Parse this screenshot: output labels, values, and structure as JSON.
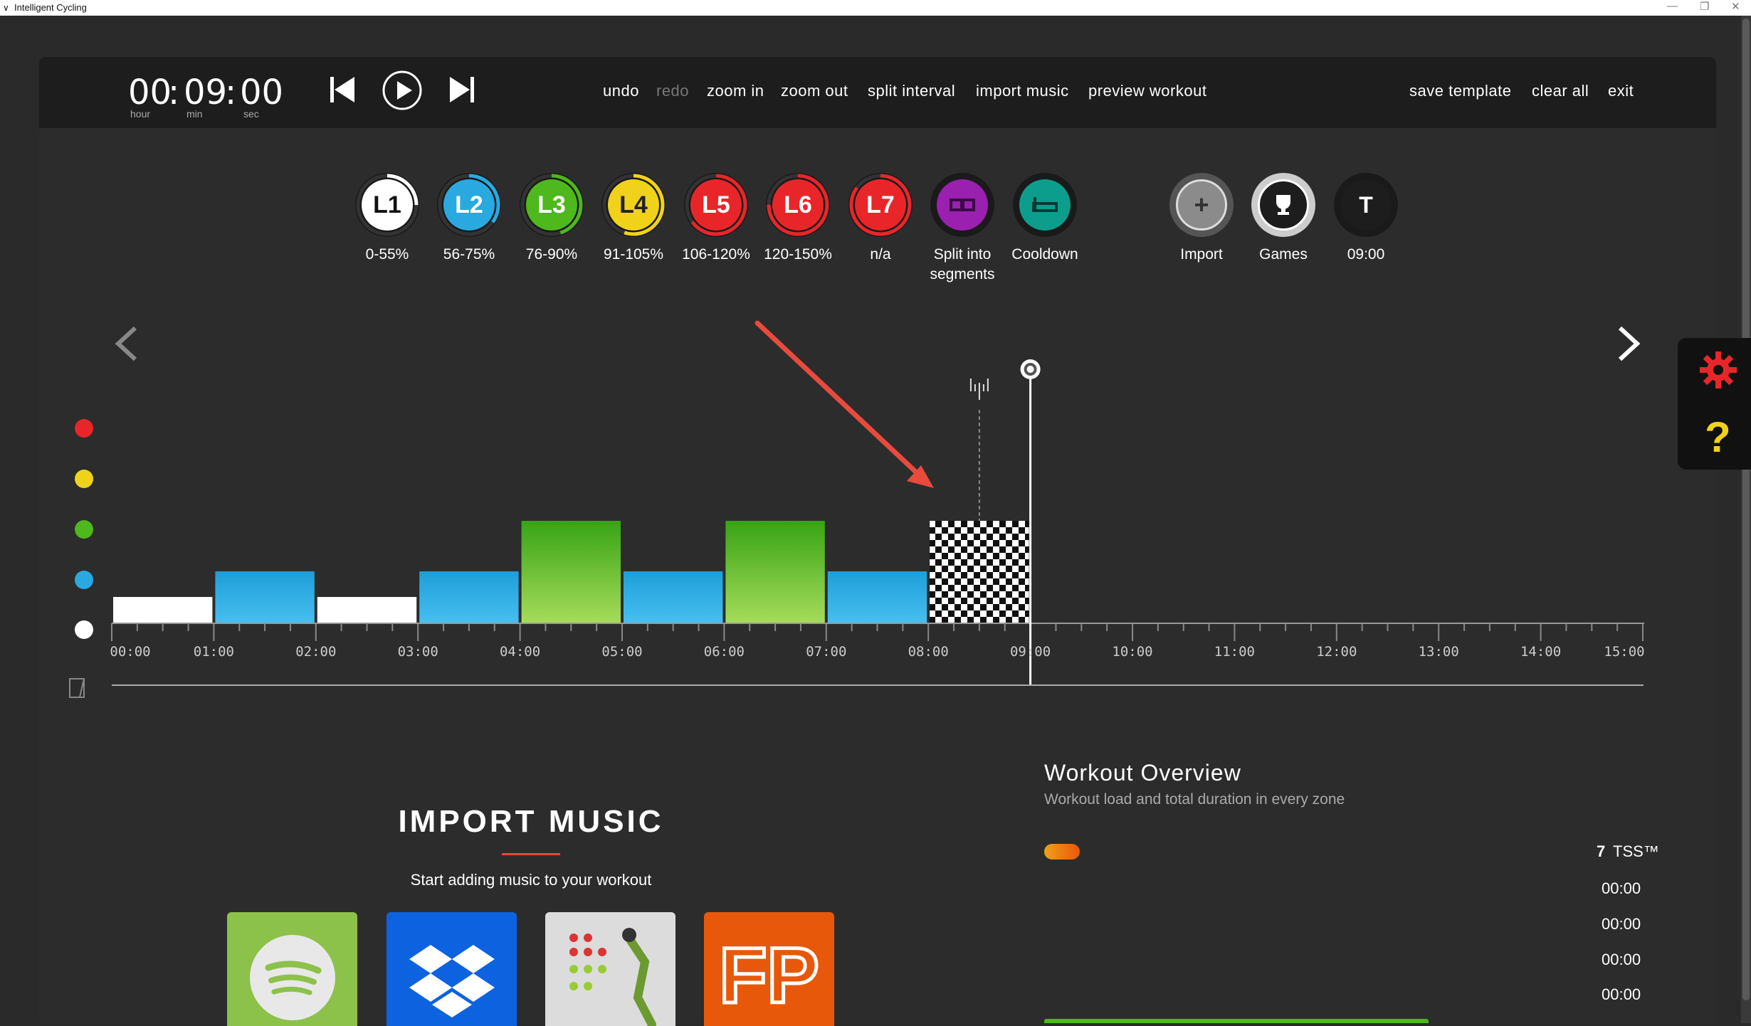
{
  "window": {
    "title": "Intelligent Cycling"
  },
  "timer": {
    "hours": "00",
    "minutes": "09",
    "seconds": "00",
    "sep": ":",
    "unit_hour": "hour",
    "unit_min": "min",
    "unit_sec": "sec"
  },
  "menu": {
    "undo": "undo",
    "redo": "redo",
    "zoom_in": "zoom in",
    "zoom_out": "zoom out",
    "split_interval": "split interval",
    "import_music": "import music",
    "preview_workout": "preview workout",
    "save_template": "save template",
    "clear_all": "clear all",
    "exit": "exit"
  },
  "zones": [
    {
      "label": "L1",
      "range": "0-55%",
      "color": "#ffffff",
      "text_color": "#111111"
    },
    {
      "label": "L2",
      "range": "56-75%",
      "color": "#29a9e0",
      "text_color": "#ffffff"
    },
    {
      "label": "L3",
      "range": "76-90%",
      "color": "#4fb81c",
      "text_color": "#ffffff"
    },
    {
      "label": "L4",
      "range": "91-105%",
      "color": "#f0d21a",
      "text_color": "#222222"
    },
    {
      "label": "L5",
      "range": "106-120%",
      "color": "#e8262a",
      "text_color": "#ffffff"
    },
    {
      "label": "L6",
      "range": "120-150%",
      "color": "#e8262a",
      "text_color": "#ffffff"
    },
    {
      "label": "L7",
      "range": "n/a",
      "color": "#e8262a",
      "text_color": "#ffffff"
    }
  ],
  "tools": {
    "split": {
      "label": "Split into segments",
      "line1": "Split into",
      "line2": "segments",
      "color": "#9a20b0"
    },
    "cooldown": {
      "label": "Cooldown",
      "color": "#0d9d8d"
    },
    "import": {
      "label": "Import",
      "icon": "plus-icon"
    },
    "games": {
      "label": "Games",
      "icon": "trophy-icon"
    },
    "total": {
      "label": "09:00",
      "glyph": "T"
    }
  },
  "timeline": {
    "ticks": [
      "00:00",
      "01:00",
      "02:00",
      "03:00",
      "04:00",
      "05:00",
      "06:00",
      "07:00",
      "08:00",
      "09:00",
      "10:00",
      "11:00",
      "12:00",
      "13:00",
      "14:00",
      "15:00"
    ],
    "intervals": [
      {
        "start_min": 0,
        "end_min": 1,
        "zone": "L1"
      },
      {
        "start_min": 1,
        "end_min": 2,
        "zone": "L2"
      },
      {
        "start_min": 2,
        "end_min": 3,
        "zone": "L1"
      },
      {
        "start_min": 3,
        "end_min": 4,
        "zone": "L2"
      },
      {
        "start_min": 4,
        "end_min": 5,
        "zone": "L3"
      },
      {
        "start_min": 5,
        "end_min": 6,
        "zone": "L2"
      },
      {
        "start_min": 6,
        "end_min": 7,
        "zone": "L3"
      },
      {
        "start_min": 7,
        "end_min": 8,
        "zone": "L2"
      },
      {
        "start_min": 8,
        "end_min": 9,
        "zone": "finish"
      }
    ],
    "cursor_min": 9,
    "split_marker_min": 8.5,
    "zone_dots": [
      "#e8262a",
      "#f0d21a",
      "#4fb81c",
      "#29a9e0",
      "#ffffff"
    ]
  },
  "import_music": {
    "title": "IMPORT MUSIC",
    "subtitle": "Start adding music to your workout",
    "services": [
      {
        "name": "Spotify",
        "color": "#8cc14a"
      },
      {
        "name": "Dropbox",
        "color": "#0d62e0"
      },
      {
        "name": "Fitness music",
        "color": "#dcdcdc"
      },
      {
        "name": "FP",
        "glyph": "FP",
        "color": "#e8580a"
      }
    ]
  },
  "overview": {
    "title": "Workout Overview",
    "subtitle": "Workout load and total duration in every zone",
    "tss_value": "7",
    "tss_label": "TSS™",
    "zone_durations": [
      "00:00",
      "00:00",
      "00:00",
      "00:00"
    ]
  },
  "annotation": {
    "color": "#e84a3c"
  }
}
